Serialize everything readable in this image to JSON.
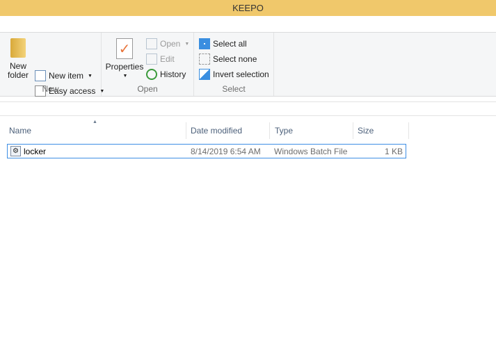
{
  "window": {
    "title": "KEEPO"
  },
  "ribbon": {
    "new": {
      "label": "New",
      "new_folder": "New\nfolder",
      "new_folder_1": "New",
      "new_folder_2": "folder",
      "new_item": "New item",
      "easy_access": "Easy access"
    },
    "open": {
      "label": "Open",
      "properties": "Properties",
      "open": "Open",
      "edit": "Edit",
      "history": "History"
    },
    "select": {
      "label": "Select",
      "select_all": "Select all",
      "select_none": "Select none",
      "invert": "Invert selection"
    }
  },
  "columns": {
    "name": "Name",
    "date": "Date modified",
    "type": "Type",
    "size": "Size"
  },
  "files": [
    {
      "name": "locker",
      "date": "8/14/2019 6:54 AM",
      "type": "Windows Batch File",
      "size": "1 KB"
    }
  ],
  "colors": {
    "title": "#f0c86b",
    "selection": "#3d8ee4"
  }
}
